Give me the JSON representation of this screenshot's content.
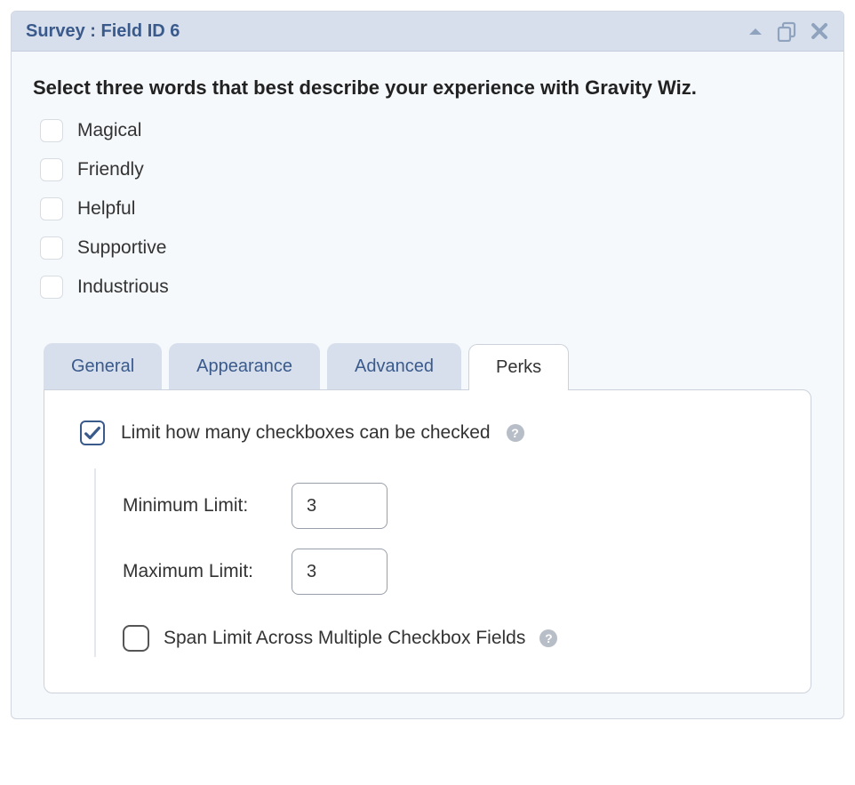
{
  "header": {
    "title": "Survey : Field ID 6"
  },
  "question": "Select three words that best describe your experience with Gravity Wiz.",
  "options": [
    {
      "label": "Magical"
    },
    {
      "label": "Friendly"
    },
    {
      "label": "Helpful"
    },
    {
      "label": "Supportive"
    },
    {
      "label": "Industrious"
    }
  ],
  "tabs": {
    "general": "General",
    "appearance": "Appearance",
    "advanced": "Advanced",
    "perks": "Perks"
  },
  "perks": {
    "limit_label": "Limit how many checkboxes can be checked",
    "min_label": "Minimum Limit:",
    "min_value": "3",
    "max_label": "Maximum Limit:",
    "max_value": "3",
    "span_label": "Span Limit Across Multiple Checkbox Fields"
  }
}
